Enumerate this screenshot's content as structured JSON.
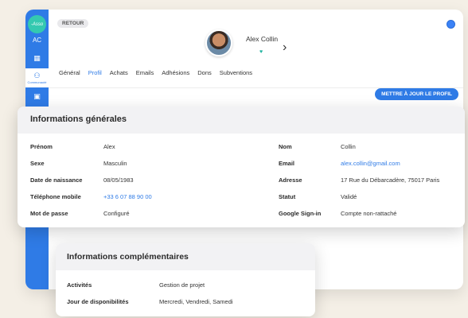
{
  "sidebar": {
    "logo_text": "-Asso",
    "initials": "AC",
    "active_item_label": "Communauté"
  },
  "header": {
    "back_label": "RETOUR",
    "profile_name": "Alex Collin"
  },
  "tabs": [
    {
      "label": "Général"
    },
    {
      "label": "Profil"
    },
    {
      "label": "Achats"
    },
    {
      "label": "Emails"
    },
    {
      "label": "Adhésions"
    },
    {
      "label": "Dons"
    },
    {
      "label": "Subventions"
    }
  ],
  "active_tab": "Profil",
  "update_button_label": "METTRE À JOUR LE PROFIL",
  "general_info": {
    "title": "Informations générales",
    "left": [
      {
        "label": "Prénom",
        "value": "Alex"
      },
      {
        "label": "Sexe",
        "value": "Masculin"
      },
      {
        "label": "Date de naissance",
        "value": "08/05/1983"
      },
      {
        "label": "Téléphone mobile",
        "value": "+33 6 07 88 90 00"
      },
      {
        "label": "Mot de passe",
        "value": "Configuré"
      }
    ],
    "right": [
      {
        "label": "Nom",
        "value": "Collin"
      },
      {
        "label": "Email",
        "value": "alex.collin@gmail.com"
      },
      {
        "label": "Adresse",
        "value": "17 Rue du Débarcadère, 75017 Paris"
      },
      {
        "label": "Statut",
        "value": "Validé"
      },
      {
        "label": "Google Sign-in",
        "value": "Compte non-rattaché"
      }
    ]
  },
  "complementary_info": {
    "title": "Informations complémentaires",
    "rows": [
      {
        "label": "Activités",
        "value": "Gestion de projet"
      },
      {
        "label": "Jour de  disponibilités",
        "value": "Mercredi, Vendredi, Samedi"
      }
    ]
  },
  "colors": {
    "accent": "#2f7be6",
    "teal": "#21b3a0",
    "background": "#f4efe6"
  }
}
